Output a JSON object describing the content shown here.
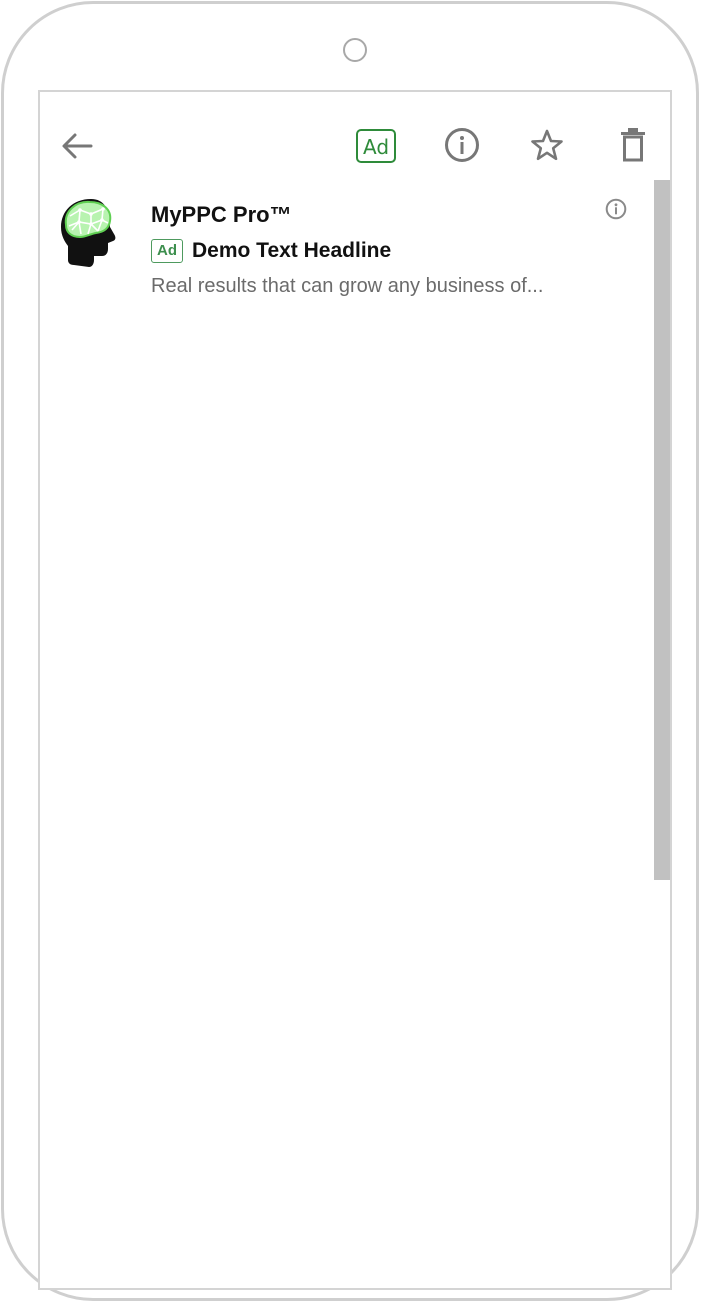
{
  "toolbar": {
    "back_icon": "arrow-left-icon",
    "ad_label": "Ad",
    "info_icon": "info-icon",
    "star_icon": "star-icon",
    "delete_icon": "trash-icon"
  },
  "ad": {
    "advertiser": "MyPPC Pro™",
    "badge": "Ad",
    "headline": "Demo Text Headline",
    "description": "Real results that can grow any business of...",
    "info_icon": "info-icon"
  },
  "colors": {
    "ad_green": "#2e8b3a",
    "icon_gray": "#777777",
    "text_dark": "#111111",
    "text_muted": "#6b6b6b"
  }
}
